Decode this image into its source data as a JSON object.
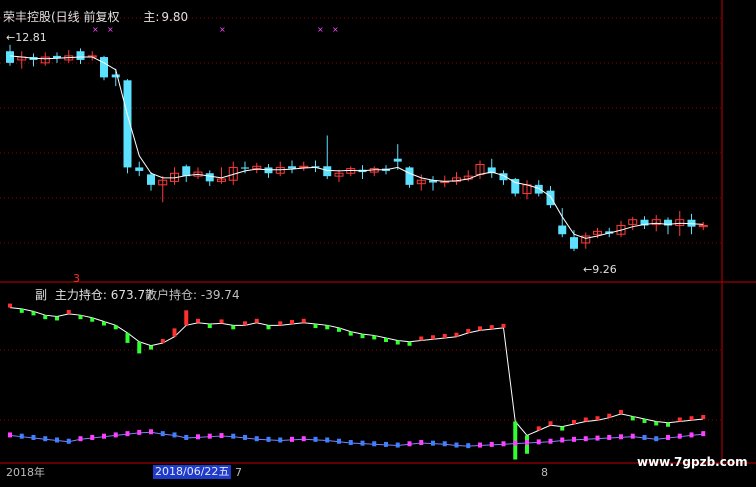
{
  "chart_title": {
    "stock": "荣丰控股(日线 前复权",
    "main_label": "主",
    "main_value": "9.80"
  },
  "high_label": "12.81",
  "low_label": "9.26",
  "indicator": {
    "index": "3",
    "prefix": "副",
    "label1": "主力持仓",
    "value1": "673.77",
    "label2": "散户持仓",
    "value2": "-39.74"
  },
  "date_axis": {
    "start": "2018年",
    "selected": "2018/06/22五",
    "tick_a": "7",
    "tick_b": "8"
  },
  "watermark": "www.7gpzb.com",
  "colors": {
    "up": "#ff3a3a",
    "down": "#5ce1ff",
    "ma": "#ffffff",
    "bg": "#000000",
    "grid": "#8b0000",
    "ind_up": "#ff3030",
    "ind_down": "#30ff30",
    "retail_up": "#ff40ff",
    "retail_down": "#4080ff"
  },
  "chart_data": [
    {
      "type": "candlestick",
      "title": "荣丰控股(日线 前复权",
      "ylim": [
        8.9,
        13.1
      ],
      "candles": [
        [
          12.7,
          12.5,
          12.81,
          12.45
        ],
        [
          12.55,
          12.6,
          12.7,
          12.4
        ],
        [
          12.6,
          12.55,
          12.66,
          12.44
        ],
        [
          12.5,
          12.6,
          12.68,
          12.45
        ],
        [
          12.62,
          12.58,
          12.68,
          12.5
        ],
        [
          12.55,
          12.62,
          12.72,
          12.5
        ],
        [
          12.7,
          12.55,
          12.75,
          12.48
        ],
        [
          12.6,
          12.62,
          12.7,
          12.54
        ],
        [
          12.6,
          12.25,
          12.62,
          12.2
        ],
        [
          12.3,
          12.25,
          12.4,
          12.1
        ],
        [
          12.2,
          10.7,
          12.22,
          10.6
        ],
        [
          10.7,
          10.64,
          10.8,
          10.55
        ],
        [
          10.58,
          10.4,
          10.62,
          10.3
        ],
        [
          10.4,
          10.48,
          10.55,
          10.1
        ],
        [
          10.46,
          10.6,
          10.7,
          10.4
        ],
        [
          10.72,
          10.55,
          10.75,
          10.45
        ],
        [
          10.55,
          10.62,
          10.7,
          10.5
        ],
        [
          10.6,
          10.46,
          10.65,
          10.38
        ],
        [
          10.46,
          10.5,
          10.7,
          10.42
        ],
        [
          10.48,
          10.7,
          10.8,
          10.4
        ],
        [
          10.7,
          10.68,
          10.8,
          10.6
        ],
        [
          10.68,
          10.72,
          10.78,
          10.6
        ],
        [
          10.7,
          10.6,
          10.76,
          10.52
        ],
        [
          10.6,
          10.7,
          10.8,
          10.55
        ],
        [
          10.72,
          10.68,
          10.82,
          10.6
        ],
        [
          10.7,
          10.72,
          10.8,
          10.64
        ],
        [
          10.72,
          10.7,
          10.82,
          10.62
        ],
        [
          10.72,
          10.55,
          11.25,
          10.5
        ],
        [
          10.55,
          10.6,
          10.66,
          10.45
        ],
        [
          10.6,
          10.68,
          10.72,
          10.55
        ],
        [
          10.66,
          10.62,
          10.74,
          10.5
        ],
        [
          10.62,
          10.68,
          10.72,
          10.55
        ],
        [
          10.68,
          10.64,
          10.74,
          10.58
        ],
        [
          10.85,
          10.8,
          11.1,
          10.66
        ],
        [
          10.7,
          10.4,
          10.72,
          10.35
        ],
        [
          10.42,
          10.48,
          10.58,
          10.3
        ],
        [
          10.48,
          10.44,
          10.55,
          10.3
        ],
        [
          10.44,
          10.46,
          10.56,
          10.36
        ],
        [
          10.46,
          10.52,
          10.62,
          10.4
        ],
        [
          10.5,
          10.55,
          10.65,
          10.46
        ],
        [
          10.58,
          10.75,
          10.82,
          10.5
        ],
        [
          10.7,
          10.6,
          10.85,
          10.52
        ],
        [
          10.6,
          10.48,
          10.65,
          10.4
        ],
        [
          10.5,
          10.25,
          10.52,
          10.2
        ],
        [
          10.25,
          10.4,
          10.48,
          10.15
        ],
        [
          10.4,
          10.25,
          10.48,
          10.2
        ],
        [
          10.3,
          10.05,
          10.38,
          10.0
        ],
        [
          9.7,
          9.55,
          10.0,
          9.5
        ],
        [
          9.5,
          9.3,
          9.62,
          9.26
        ],
        [
          9.4,
          9.52,
          9.58,
          9.3
        ],
        [
          9.55,
          9.6,
          9.66,
          9.48
        ],
        [
          9.6,
          9.56,
          9.66,
          9.5
        ],
        [
          9.55,
          9.7,
          9.78,
          9.5
        ],
        [
          9.72,
          9.8,
          9.85,
          9.62
        ],
        [
          9.8,
          9.7,
          9.86,
          9.64
        ],
        [
          9.72,
          9.8,
          9.88,
          9.6
        ],
        [
          9.8,
          9.7,
          9.84,
          9.55
        ],
        [
          9.7,
          9.8,
          9.95,
          9.52
        ],
        [
          9.8,
          9.68,
          9.9,
          9.55
        ],
        [
          9.68,
          9.7,
          9.76,
          9.62
        ]
      ],
      "ma": [
        12.62,
        12.6,
        12.58,
        12.57,
        12.58,
        12.59,
        12.6,
        12.6,
        12.5,
        12.38,
        11.6,
        10.9,
        10.6,
        10.52,
        10.52,
        10.56,
        10.58,
        10.55,
        10.52,
        10.58,
        10.64,
        10.67,
        10.66,
        10.66,
        10.67,
        10.69,
        10.7,
        10.65,
        10.64,
        10.65,
        10.64,
        10.66,
        10.66,
        10.7,
        10.6,
        10.52,
        10.48,
        10.46,
        10.47,
        10.5,
        10.58,
        10.62,
        10.56,
        10.44,
        10.4,
        10.34,
        10.2,
        9.85,
        9.55,
        9.48,
        9.52,
        9.57,
        9.62,
        9.68,
        9.72,
        9.74,
        9.72,
        9.74,
        9.73,
        9.72
      ]
    },
    {
      "type": "line",
      "title": "主力持仓",
      "ylim": [
        -520,
        760
      ],
      "series": [
        {
          "name": "主力持仓",
          "values": [
            700,
            690,
            670,
            640,
            630,
            650,
            640,
            620,
            590,
            560,
            500,
            430,
            400,
            420,
            470,
            560,
            580,
            570,
            575,
            560,
            560,
            580,
            560,
            560,
            570,
            580,
            570,
            560,
            540,
            510,
            490,
            480,
            460,
            440,
            430,
            440,
            450,
            460,
            470,
            500,
            520,
            530,
            540,
            -200,
            -310,
            -270,
            -230,
            -240,
            -220,
            -200,
            -190,
            -170,
            -140,
            -160,
            -180,
            -200,
            -210,
            -200,
            -190,
            -180
          ]
        },
        {
          "name": "散户持仓",
          "values": [
            -310,
            -320,
            -330,
            -340,
            -350,
            -360,
            -340,
            -330,
            -320,
            -310,
            -300,
            -290,
            -285,
            -300,
            -310,
            -330,
            -325,
            -320,
            -315,
            -320,
            -330,
            -340,
            -345,
            -350,
            -345,
            -340,
            -345,
            -350,
            -360,
            -370,
            -375,
            -380,
            -385,
            -390,
            -380,
            -370,
            -375,
            -380,
            -390,
            -395,
            -390,
            -385,
            -380,
            -375,
            -370,
            -365,
            -360,
            -350,
            -345,
            -340,
            -335,
            -330,
            -325,
            -320,
            -330,
            -340,
            -330,
            -320,
            -310,
            -300
          ]
        }
      ]
    }
  ]
}
